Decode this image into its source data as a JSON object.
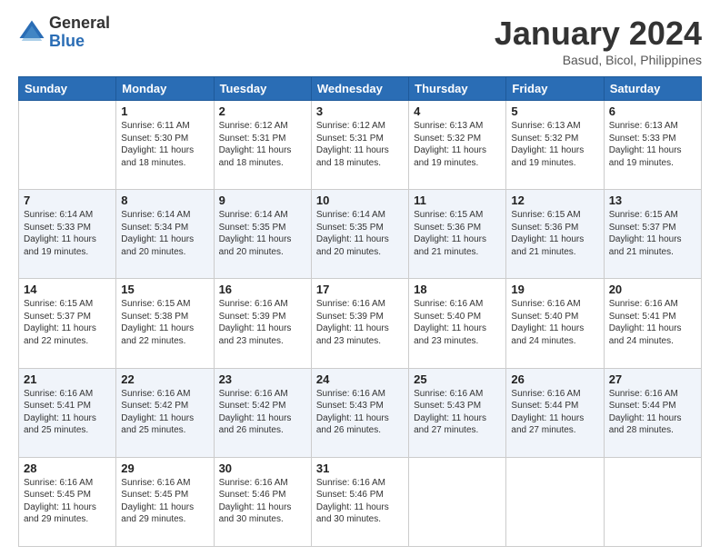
{
  "logo": {
    "general": "General",
    "blue": "Blue"
  },
  "header": {
    "month": "January 2024",
    "location": "Basud, Bicol, Philippines"
  },
  "weekdays": [
    "Sunday",
    "Monday",
    "Tuesday",
    "Wednesday",
    "Thursday",
    "Friday",
    "Saturday"
  ],
  "weeks": [
    [
      {
        "day": "",
        "info": ""
      },
      {
        "day": "1",
        "info": "Sunrise: 6:11 AM\nSunset: 5:30 PM\nDaylight: 11 hours\nand 18 minutes."
      },
      {
        "day": "2",
        "info": "Sunrise: 6:12 AM\nSunset: 5:31 PM\nDaylight: 11 hours\nand 18 minutes."
      },
      {
        "day": "3",
        "info": "Sunrise: 6:12 AM\nSunset: 5:31 PM\nDaylight: 11 hours\nand 18 minutes."
      },
      {
        "day": "4",
        "info": "Sunrise: 6:13 AM\nSunset: 5:32 PM\nDaylight: 11 hours\nand 19 minutes."
      },
      {
        "day": "5",
        "info": "Sunrise: 6:13 AM\nSunset: 5:32 PM\nDaylight: 11 hours\nand 19 minutes."
      },
      {
        "day": "6",
        "info": "Sunrise: 6:13 AM\nSunset: 5:33 PM\nDaylight: 11 hours\nand 19 minutes."
      }
    ],
    [
      {
        "day": "7",
        "info": "Sunrise: 6:14 AM\nSunset: 5:33 PM\nDaylight: 11 hours\nand 19 minutes."
      },
      {
        "day": "8",
        "info": "Sunrise: 6:14 AM\nSunset: 5:34 PM\nDaylight: 11 hours\nand 20 minutes."
      },
      {
        "day": "9",
        "info": "Sunrise: 6:14 AM\nSunset: 5:35 PM\nDaylight: 11 hours\nand 20 minutes."
      },
      {
        "day": "10",
        "info": "Sunrise: 6:14 AM\nSunset: 5:35 PM\nDaylight: 11 hours\nand 20 minutes."
      },
      {
        "day": "11",
        "info": "Sunrise: 6:15 AM\nSunset: 5:36 PM\nDaylight: 11 hours\nand 21 minutes."
      },
      {
        "day": "12",
        "info": "Sunrise: 6:15 AM\nSunset: 5:36 PM\nDaylight: 11 hours\nand 21 minutes."
      },
      {
        "day": "13",
        "info": "Sunrise: 6:15 AM\nSunset: 5:37 PM\nDaylight: 11 hours\nand 21 minutes."
      }
    ],
    [
      {
        "day": "14",
        "info": "Sunrise: 6:15 AM\nSunset: 5:37 PM\nDaylight: 11 hours\nand 22 minutes."
      },
      {
        "day": "15",
        "info": "Sunrise: 6:15 AM\nSunset: 5:38 PM\nDaylight: 11 hours\nand 22 minutes."
      },
      {
        "day": "16",
        "info": "Sunrise: 6:16 AM\nSunset: 5:39 PM\nDaylight: 11 hours\nand 23 minutes."
      },
      {
        "day": "17",
        "info": "Sunrise: 6:16 AM\nSunset: 5:39 PM\nDaylight: 11 hours\nand 23 minutes."
      },
      {
        "day": "18",
        "info": "Sunrise: 6:16 AM\nSunset: 5:40 PM\nDaylight: 11 hours\nand 23 minutes."
      },
      {
        "day": "19",
        "info": "Sunrise: 6:16 AM\nSunset: 5:40 PM\nDaylight: 11 hours\nand 24 minutes."
      },
      {
        "day": "20",
        "info": "Sunrise: 6:16 AM\nSunset: 5:41 PM\nDaylight: 11 hours\nand 24 minutes."
      }
    ],
    [
      {
        "day": "21",
        "info": "Sunrise: 6:16 AM\nSunset: 5:41 PM\nDaylight: 11 hours\nand 25 minutes."
      },
      {
        "day": "22",
        "info": "Sunrise: 6:16 AM\nSunset: 5:42 PM\nDaylight: 11 hours\nand 25 minutes."
      },
      {
        "day": "23",
        "info": "Sunrise: 6:16 AM\nSunset: 5:42 PM\nDaylight: 11 hours\nand 26 minutes."
      },
      {
        "day": "24",
        "info": "Sunrise: 6:16 AM\nSunset: 5:43 PM\nDaylight: 11 hours\nand 26 minutes."
      },
      {
        "day": "25",
        "info": "Sunrise: 6:16 AM\nSunset: 5:43 PM\nDaylight: 11 hours\nand 27 minutes."
      },
      {
        "day": "26",
        "info": "Sunrise: 6:16 AM\nSunset: 5:44 PM\nDaylight: 11 hours\nand 27 minutes."
      },
      {
        "day": "27",
        "info": "Sunrise: 6:16 AM\nSunset: 5:44 PM\nDaylight: 11 hours\nand 28 minutes."
      }
    ],
    [
      {
        "day": "28",
        "info": "Sunrise: 6:16 AM\nSunset: 5:45 PM\nDaylight: 11 hours\nand 29 minutes."
      },
      {
        "day": "29",
        "info": "Sunrise: 6:16 AM\nSunset: 5:45 PM\nDaylight: 11 hours\nand 29 minutes."
      },
      {
        "day": "30",
        "info": "Sunrise: 6:16 AM\nSunset: 5:46 PM\nDaylight: 11 hours\nand 30 minutes."
      },
      {
        "day": "31",
        "info": "Sunrise: 6:16 AM\nSunset: 5:46 PM\nDaylight: 11 hours\nand 30 minutes."
      },
      {
        "day": "",
        "info": ""
      },
      {
        "day": "",
        "info": ""
      },
      {
        "day": "",
        "info": ""
      }
    ]
  ]
}
